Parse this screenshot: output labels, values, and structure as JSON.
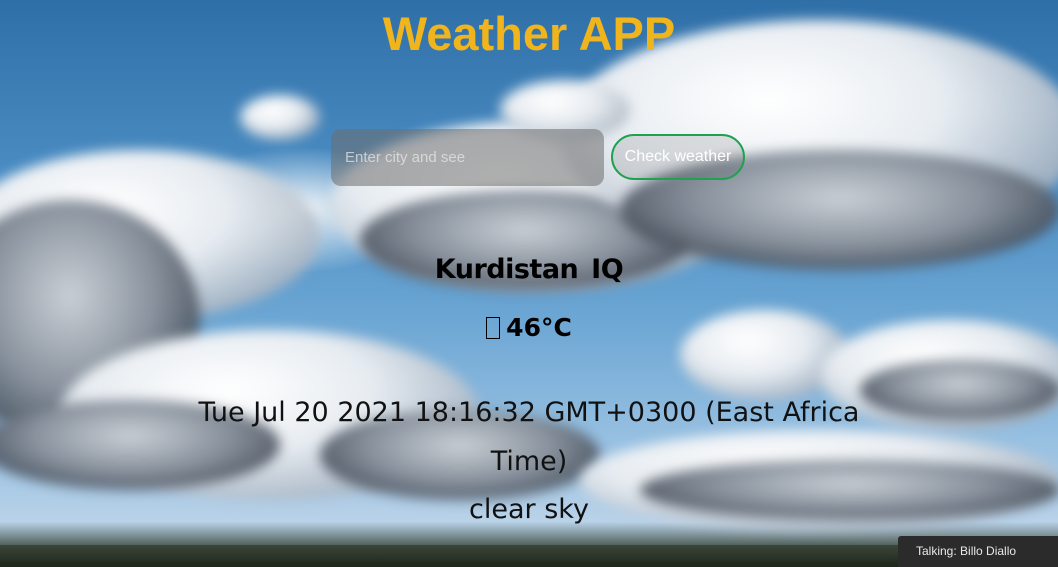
{
  "app": {
    "title": "Weather APP"
  },
  "search": {
    "placeholder": "Enter city and see",
    "value": "",
    "button_label": "Check weather"
  },
  "weather": {
    "location": "Kurdistan  IQ",
    "temperature": "46°C",
    "datetime": "Tue Jul 20 2021 18:16:32 GMT+0300 (East Africa Time)",
    "description": "clear sky"
  },
  "overlay": {
    "talking_label": "Talking: Billo Diallo"
  },
  "colors": {
    "title": "#f0b41c",
    "button_border": "#20a150",
    "sky": "#4a8cc2"
  }
}
